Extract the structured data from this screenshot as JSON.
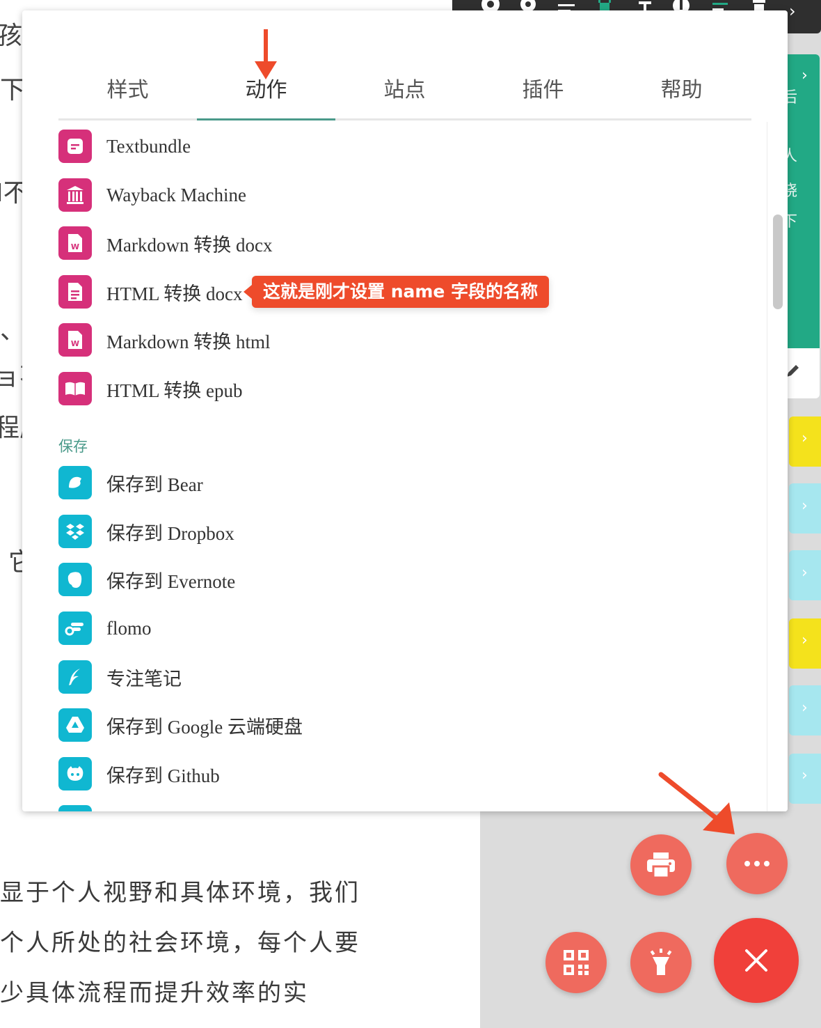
{
  "article": {
    "fragments": [
      "孩扌",
      "下",
      "I不",
      "、",
      "ョ不",
      "程度",
      "它"
    ],
    "paragraph_lines": [
      "显于个人视野和具体环境，我们",
      "个人所处的社会环境，每个人要",
      "少具体流程而提升效率的实"
    ]
  },
  "side": {
    "green_chars": [
      "后",
      "人",
      "晓",
      "下"
    ]
  },
  "popup": {
    "tabs": [
      "样式",
      "动作",
      "站点",
      "插件",
      "帮助"
    ],
    "active_tab_index": 1,
    "accent_color": "#4a9a8a",
    "action_items": [
      {
        "label": "Textbundle",
        "icon": "textbundle-icon"
      },
      {
        "label": "Wayback Machine",
        "icon": "archive-building-icon"
      },
      {
        "label": "Markdown 转换 docx",
        "icon": "word-doc-icon"
      },
      {
        "label": "HTML 转换 docx",
        "icon": "document-icon"
      },
      {
        "label": "Markdown 转换 html",
        "icon": "word-doc-icon"
      },
      {
        "label": "HTML 转换 epub",
        "icon": "open-book-icon"
      }
    ],
    "save_section_title": "保存",
    "save_items": [
      {
        "label": "保存到 Bear",
        "icon": "bear-icon"
      },
      {
        "label": "保存到 Dropbox",
        "icon": "dropbox-icon"
      },
      {
        "label": "保存到 Evernote",
        "icon": "evernote-icon"
      },
      {
        "label": "flomo",
        "icon": "flomo-icon"
      },
      {
        "label": "专注笔记",
        "icon": "feather-icon"
      },
      {
        "label": "保存到 Google 云端硬盘",
        "icon": "google-drive-icon"
      },
      {
        "label": "保存到 Github",
        "icon": "github-icon"
      }
    ]
  },
  "annotation": {
    "callout_text": "这就是刚才设置 name 字段的名称",
    "color": "#ee4b2b"
  },
  "fabs": {
    "print": "print-icon",
    "more": "more-dots-icon",
    "qrcode": "qrcode-icon",
    "flashlight": "flashlight-icon",
    "close": "close-icon"
  }
}
